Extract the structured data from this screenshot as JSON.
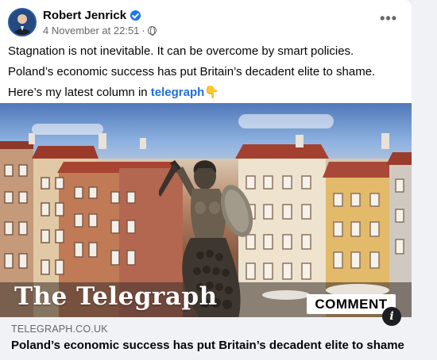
{
  "post": {
    "author": "Robert Jenrick",
    "timestamp": "4 November at 22:51",
    "separator": "·",
    "more_label": "•••",
    "body_lines": [
      "Stagnation is not inevitable. It can be overcome by smart policies.",
      "Poland’s economic success has put Britain’s decadent elite to shame."
    ],
    "cta_prefix": "Here’s my latest column in ",
    "cta_link": "telegraph",
    "cta_emoji": "👇",
    "image": {
      "logo_text": "The Telegraph",
      "badge_text": "COMMENT",
      "info_label": "i"
    },
    "link_card": {
      "domain": "TELEGRAPH.CO.UK",
      "headline": "Poland’s economic success has put Britain’s decadent elite to shame"
    }
  },
  "colors": {
    "link": "#216fdb",
    "verified": "#1877f2",
    "card_bg": "#f0f2f5"
  },
  "icons": [
    "verified-badge-icon",
    "globe-icon",
    "more-options-icon",
    "info-icon"
  ]
}
